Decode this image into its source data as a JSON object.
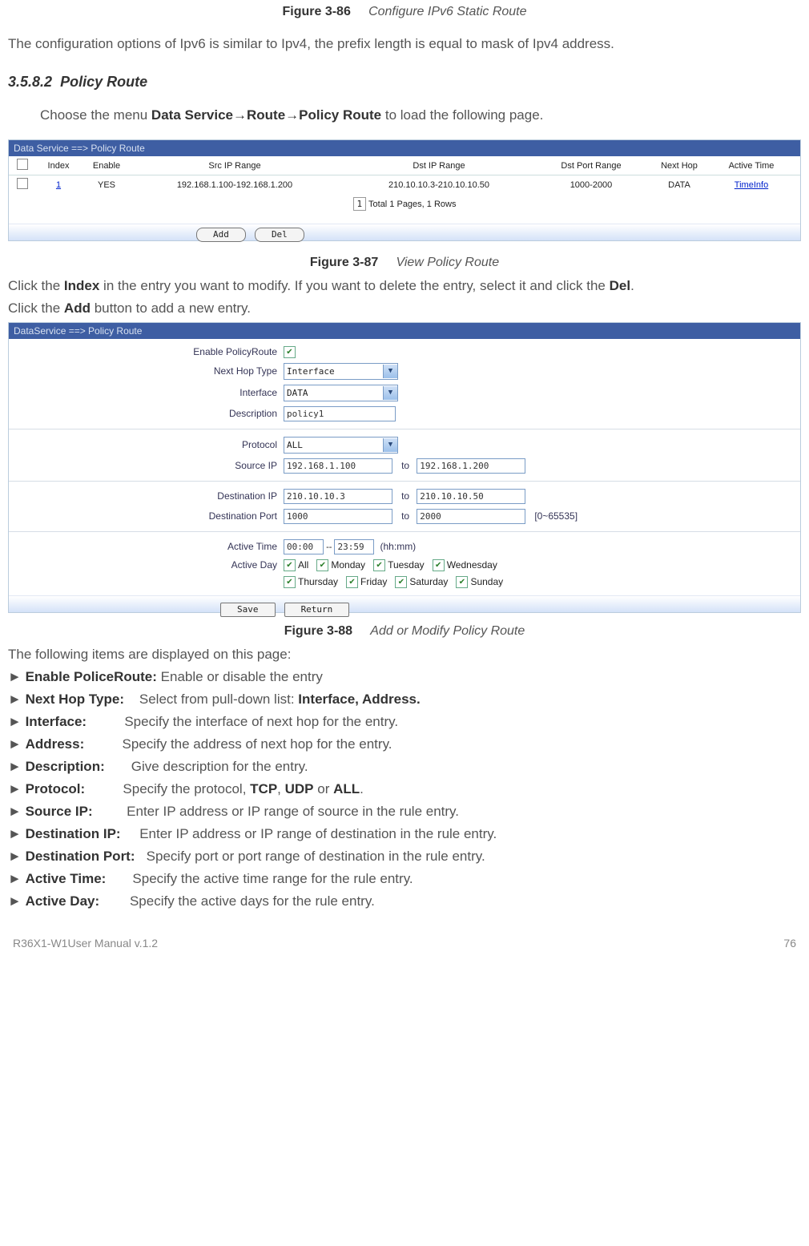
{
  "fig86": {
    "number": "Figure 3-86",
    "title": "Configure IPv6 Static Route"
  },
  "intro86": "The configuration options of Ipv6 is similar to Ipv4, the prefix length is equal to mask of Ipv4 address.",
  "section": {
    "number": "3.5.8.2",
    "title": "Policy Route"
  },
  "menu_sentence": {
    "p1": "Choose the menu ",
    "b1": "Data Service",
    "arrow": "→",
    "b2": "Route",
    "b3": "Policy Route",
    "p2": " to load the following page."
  },
  "view_panel": {
    "breadcrumb": "Data Service ==> Policy Route",
    "headers": {
      "index": "Index",
      "enable": "Enable",
      "src": "Src IP Range",
      "dst": "Dst IP Range",
      "dport": "Dst Port Range",
      "nexthop": "Next Hop",
      "atime": "Active Time"
    },
    "row": {
      "index": "1",
      "enable": "YES",
      "src": "192.168.1.100-192.168.1.200",
      "dst": "210.10.10.3-210.10.10.50",
      "dport": "1000-2000",
      "nexthop": "DATA",
      "atime": "TimeInfo"
    },
    "pagination": {
      "page": "1",
      "text": "Total 1 Pages, 1 Rows"
    },
    "add": "Add",
    "del": "Del"
  },
  "fig87": {
    "number": "Figure 3-87",
    "title": "View Policy Route"
  },
  "after87_p1a": "Click the ",
  "after87_p1b": "Index",
  "after87_p1c": " in the entry you want to modify. If you want to delete the entry, select it and click the ",
  "after87_p1d": "Del",
  "after87_p1e": ".",
  "after87_p2a": "Click the ",
  "after87_p2b": "Add",
  "after87_p2c": " button to add a new entry.",
  "form_panel": {
    "breadcrumb": "DataService ==> Policy Route",
    "labels": {
      "enable": "Enable PolicyRoute",
      "nht": "Next Hop Type",
      "iface": "Interface",
      "desc": "Description",
      "proto": "Protocol",
      "sip": "Source IP",
      "dip": "Destination IP",
      "dport": "Destination Port",
      "atime": "Active Time",
      "aday": "Active Day"
    },
    "values": {
      "nht": "Interface",
      "iface": "DATA",
      "desc": "policy1",
      "proto": "ALL",
      "sip_from": "192.168.1.100",
      "sip_to": "192.168.1.200",
      "dip_from": "210.10.10.3",
      "dip_to": "210.10.10.50",
      "dport_from": "1000",
      "dport_to": "2000",
      "atime_from": "00:00",
      "atime_to": "23:59"
    },
    "to": "to",
    "port_hint": "[0~65535]",
    "time_sep": "--",
    "time_hint": "(hh:mm)",
    "days": {
      "all": "All",
      "mon": "Monday",
      "tue": "Tuesday",
      "wed": "Wednesday",
      "thu": "Thursday",
      "fri": "Friday",
      "sat": "Saturday",
      "sun": "Sunday"
    },
    "save": "Save",
    "ret": "Return"
  },
  "fig88": {
    "number": "Figure 3-88",
    "title": "Add or Modify Policy Route"
  },
  "glossary_intro": "The following items are displayed on this page:",
  "glossary": {
    "enable": {
      "term": "Enable PoliceRoute:",
      "def": " Enable or disable the entry"
    },
    "nht": {
      "term": "Next Hop Type:",
      "def_a": "    Select from pull-down list: ",
      "def_b": "Interface, Address."
    },
    "iface": {
      "term": "Interface:",
      "def": "          Specify the interface of next hop for the entry."
    },
    "addr": {
      "term": "Address:",
      "def": "          Specify the address of next hop for the entry."
    },
    "desc": {
      "term": "Description:",
      "def": "       Give description for the entry."
    },
    "proto": {
      "term": "Protocol:",
      "def_a": "          Specify the protocol, ",
      "b1": "TCP",
      "mid": ", ",
      "b2": "UDP",
      "mid2": " or ",
      "b3": "ALL",
      "end": "."
    },
    "sip": {
      "term": "Source IP:",
      "def": "         Enter IP address or IP range of source in the rule entry."
    },
    "dip": {
      "term": "Destination IP:",
      "def": "     Enter IP address or IP range of destination in the rule entry."
    },
    "dport": {
      "term": "Destination Port:",
      "def": "   Specify port or port range of destination in the rule entry."
    },
    "atime": {
      "term": "Active Time:",
      "def": "       Specify the active time range for the rule entry."
    },
    "aday": {
      "term": "Active Day:",
      "def": "        Specify the active days for the rule entry."
    }
  },
  "footer": {
    "left": "R36X1-W1User Manual v.1.2",
    "right": "76"
  }
}
